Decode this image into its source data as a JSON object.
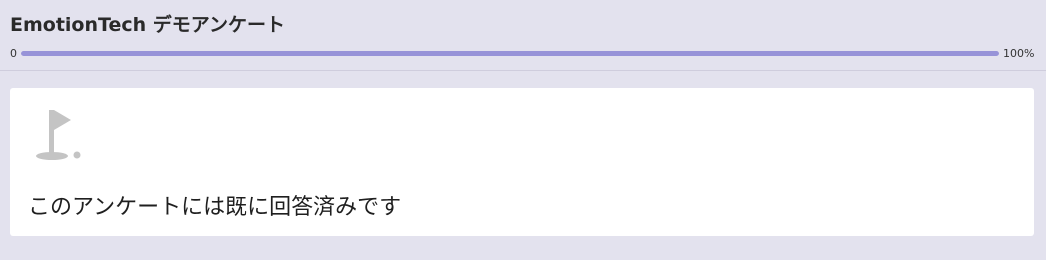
{
  "header": {
    "title": "EmotionTech デモアンケート"
  },
  "progress": {
    "start_label": "0",
    "end_label": "100%",
    "value_percent": 100
  },
  "card": {
    "icon": "flag-icon",
    "message": "このアンケートには既に回答済みです"
  },
  "colors": {
    "background": "#e3e2ee",
    "progress_fill": "#9793d8",
    "icon_gray": "#c4c4c4"
  }
}
